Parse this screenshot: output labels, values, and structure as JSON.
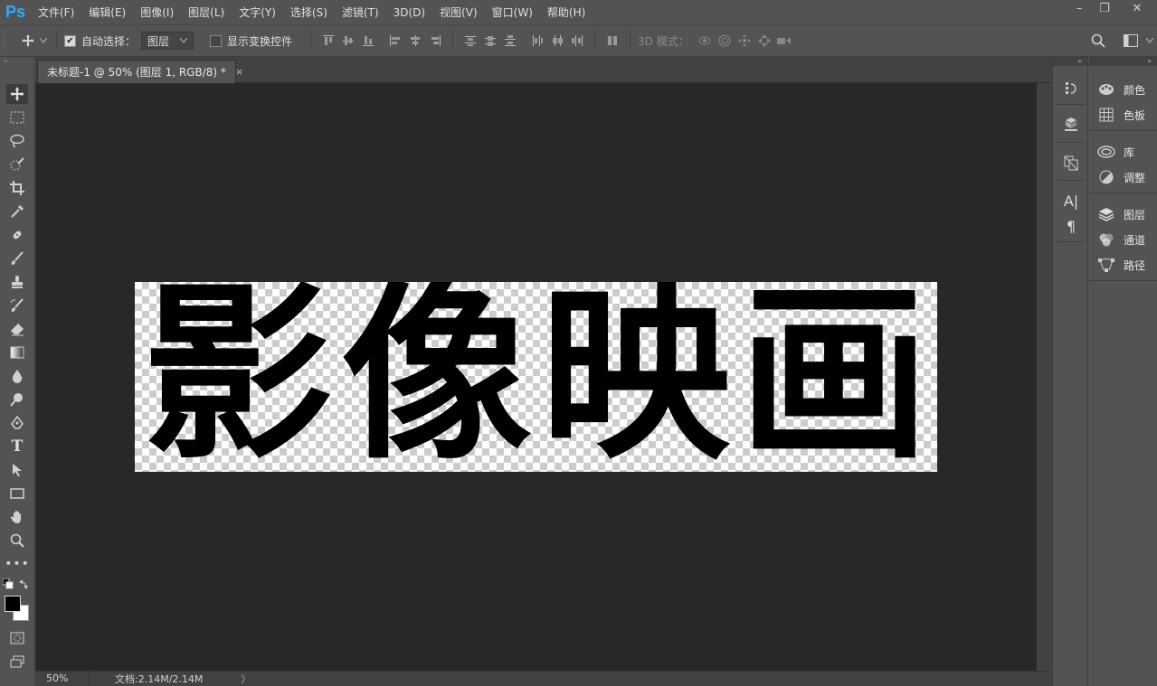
{
  "app": {
    "logo": "Ps"
  },
  "menu": [
    "文件(F)",
    "编辑(E)",
    "图像(I)",
    "图层(L)",
    "文字(Y)",
    "选择(S)",
    "滤镜(T)",
    "3D(D)",
    "视图(V)",
    "窗口(W)",
    "帮助(H)"
  ],
  "window_controls": {
    "minimize": "–",
    "restore": "❐",
    "close": "✕"
  },
  "options": {
    "auto_select_label": "自动选择：",
    "auto_select_checked": true,
    "auto_select_value": "图层",
    "show_transform_label": "显示变换控件",
    "show_transform_checked": false,
    "mode_3d_label": "3D 模式："
  },
  "document": {
    "tab_title": "未标题-1 @ 50% (图层 1, RGB/8) *",
    "tab_close": "×",
    "artwork_chars": [
      "影",
      "像",
      "映",
      "画"
    ]
  },
  "status": {
    "zoom": "50%",
    "doc_size": "文档:2.14M/2.14M",
    "arrow": "〉"
  },
  "panels": [
    {
      "label": "颜色",
      "icon": "palette-icon"
    },
    {
      "label": "色板",
      "icon": "grid-icon"
    },
    {
      "label": "库",
      "icon": "cloud-library-icon"
    },
    {
      "label": "调整",
      "icon": "half-circle-icon"
    },
    {
      "label": "图层",
      "icon": "layers-icon"
    },
    {
      "label": "通道",
      "icon": "channels-icon"
    },
    {
      "label": "路径",
      "icon": "path-icon"
    }
  ],
  "colors": {
    "accent": "#31a8ff",
    "foreground": "#000000",
    "background": "#ffffff"
  }
}
